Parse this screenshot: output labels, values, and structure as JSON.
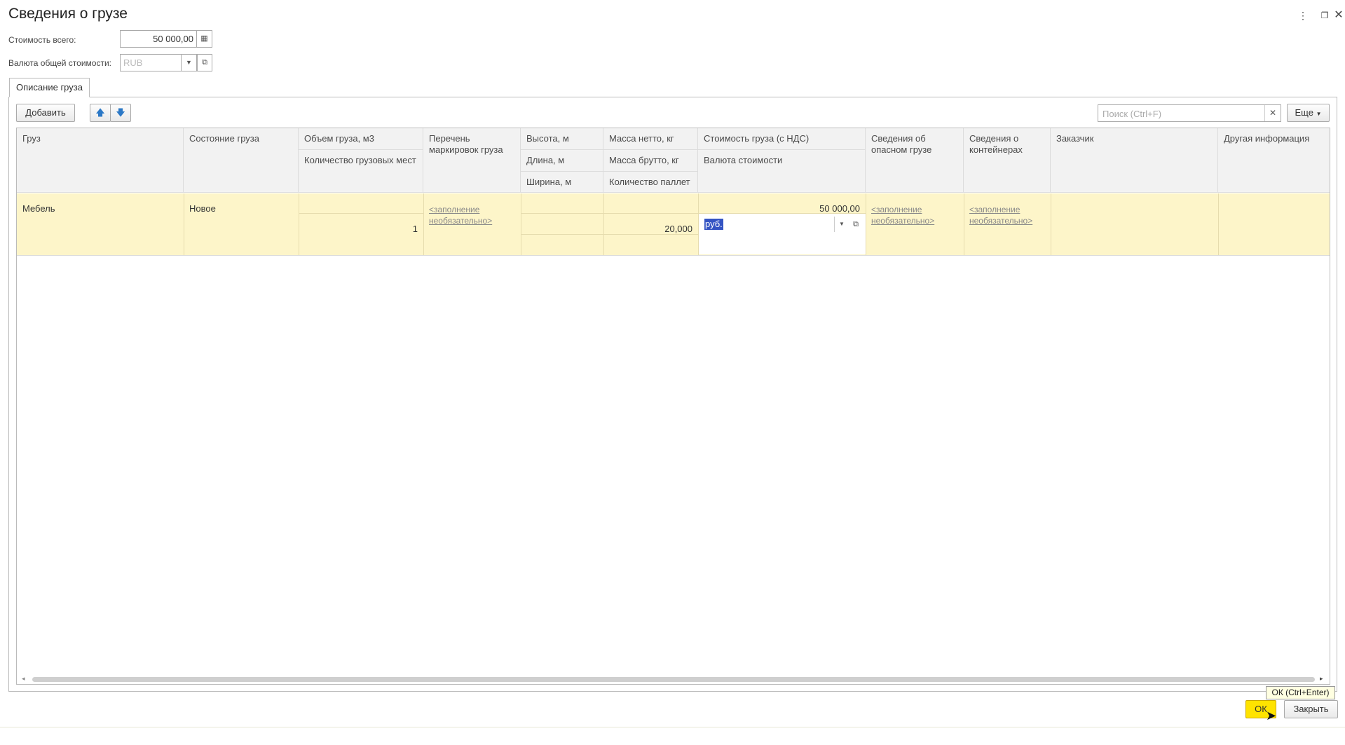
{
  "window": {
    "title": "Сведения о грузе",
    "icons": {
      "more": "more-vert-icon",
      "restore": "restore-window-icon",
      "close": "close-icon"
    }
  },
  "fields": {
    "total_cost": {
      "label": "Стоимость всего:",
      "value": "50 000,00",
      "icon": "calculator-icon"
    },
    "currency": {
      "label": "Валюта общей стоимости:",
      "placeholder": "RUB",
      "icon_dropdown": "chevron-down-icon",
      "icon_open": "open-external-icon"
    }
  },
  "tabs": [
    {
      "label": "Описание груза"
    }
  ],
  "toolbar": {
    "add_label": "Добавить",
    "up_icon": "arrow-up-icon",
    "down_icon": "arrow-down-icon",
    "search_placeholder": "Поиск (Ctrl+F)",
    "more_label": "Еще"
  },
  "table": {
    "columns": {
      "cargo": "Груз",
      "state": "Состояние груза",
      "volume": "Объем груза, м3",
      "places": "Количество грузовых мест",
      "markings": "Перечень маркировок груза",
      "height": "Высота, м",
      "length": "Длина, м",
      "width": "Ширина, м",
      "net_mass": "Масса нетто, кг",
      "gross_mass": "Масса брутто, кг",
      "pallets": "Количество  паллет",
      "cost": "Стоимость груза (с НДС)",
      "cost_currency": "Валюта стоимости",
      "dangerous": "Сведения об опасном грузе",
      "containers": "Сведения о контейнерах",
      "customer": "Заказчик",
      "other": "Другая информация"
    },
    "rows": [
      {
        "cargo": "Мебель",
        "state": "Новое",
        "places": "1",
        "markings": "<заполнение необязательно>",
        "gross_mass": "20,000",
        "cost": "50 000,00",
        "cost_currency": "руб.",
        "dangerous": "<заполнение необязательно>",
        "containers": "<заполнение необязательно>"
      }
    ]
  },
  "footer": {
    "ok_label": "ОК",
    "ok_tooltip": "ОК (Ctrl+Enter)",
    "close_label": "Закрыть"
  },
  "colors": {
    "accent_ok": "#ffe300",
    "row_selected": "#fdf5c9",
    "link": "#888888"
  }
}
